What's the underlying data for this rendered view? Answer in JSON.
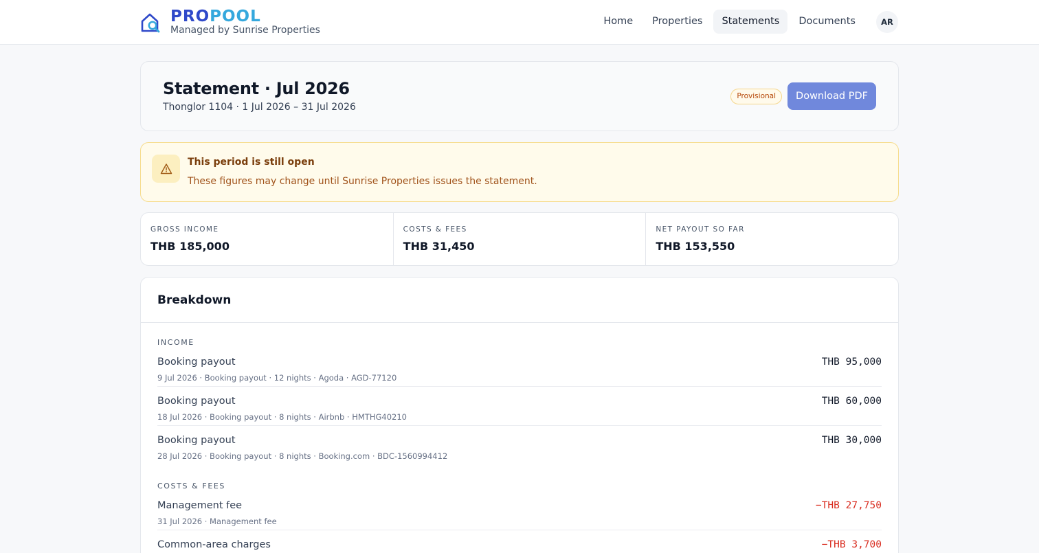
{
  "brand": {
    "wordmark_part1": "PRO",
    "wordmark_part2": "POOL",
    "subtitle": "Managed by Sunrise Properties",
    "color_primary": "#2f49c9",
    "color_secondary": "#35a8dd"
  },
  "nav": {
    "items": [
      {
        "label": "Home",
        "active": false
      },
      {
        "label": "Properties",
        "active": false
      },
      {
        "label": "Statements",
        "active": true
      },
      {
        "label": "Documents",
        "active": false
      }
    ],
    "avatar_initials": "AR"
  },
  "statement": {
    "title": "Statement · Jul 2026",
    "subtitle": "Thonglor 1104 · 1 Jul 2026 – 31 Jul 2026",
    "status_badge": "Provisional",
    "download_label": "Download PDF",
    "accent_color": "#7088dc"
  },
  "alert": {
    "icon": "warning-icon",
    "title": "This period is still open",
    "body": "These figures may change until Sunrise Properties issues the statement."
  },
  "totals": [
    {
      "label": "GROSS INCOME",
      "value": "THB 185,000"
    },
    {
      "label": "COSTS & FEES",
      "value": "THB 31,450"
    },
    {
      "label": "NET PAYOUT SO FAR",
      "value": "THB 153,550"
    }
  ],
  "breakdown": {
    "title": "Breakdown",
    "income": {
      "label": "INCOME",
      "rows": [
        {
          "name": "Booking payout",
          "meta": "9 Jul 2026 · Booking payout · 12 nights · Agoda · AGD-77120",
          "amount": "THB 95,000"
        },
        {
          "name": "Booking payout",
          "meta": "18 Jul 2026 · Booking payout · 8 nights · Airbnb · HMTHG40210",
          "amount": "THB 60,000"
        },
        {
          "name": "Booking payout",
          "meta": "28 Jul 2026 · Booking payout · 8 nights · Booking.com · BDC-1560994412",
          "amount": "THB 30,000"
        }
      ]
    },
    "costs": {
      "label": "COSTS & FEES",
      "rows": [
        {
          "name": "Management fee",
          "meta": "31 Jul 2026 · Management fee",
          "amount": "−THB 27,750"
        },
        {
          "name": "Common-area charges",
          "meta": "",
          "amount": "−THB 3,700"
        }
      ]
    },
    "negative_color": "#d92d20"
  }
}
